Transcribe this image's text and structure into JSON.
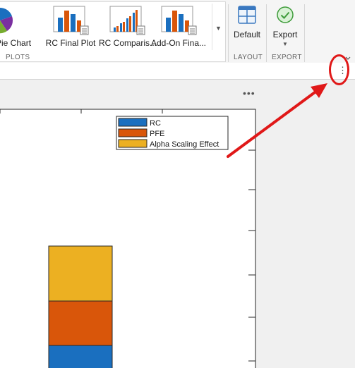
{
  "toolstrip": {
    "plots": {
      "items": [
        {
          "label": "Pie Chart",
          "icon": "pie-chart-icon"
        },
        {
          "label": "RC Final Plot",
          "icon": "bar-chart-icon"
        },
        {
          "label": "RC Comparis...",
          "icon": "bar-comparison-icon"
        },
        {
          "label": "Add-On Fina...",
          "icon": "bar-chart-icon"
        }
      ],
      "group_label": "PLOTS"
    },
    "layout": {
      "default_label": "Default",
      "group_label": "LAYOUT"
    },
    "export": {
      "export_label": "Export",
      "group_label": "EXPORT"
    }
  },
  "kebab_glyph": "⋮",
  "axes_menu_glyph": "•••",
  "colors": {
    "rc": "#1a6fbf",
    "pfe": "#d9560a",
    "alpha": "#ecb022",
    "annotation": "#e01818"
  },
  "chart_data": {
    "type": "bar",
    "stacked": true,
    "categories": [
      ""
    ],
    "series": [
      {
        "name": "RC",
        "color": "#1a6fbf"
      },
      {
        "name": "PFE",
        "color": "#d9560a"
      },
      {
        "name": "Alpha Scaling Effect",
        "color": "#ecb022"
      }
    ],
    "legend_position": "top-right",
    "grid": false
  }
}
